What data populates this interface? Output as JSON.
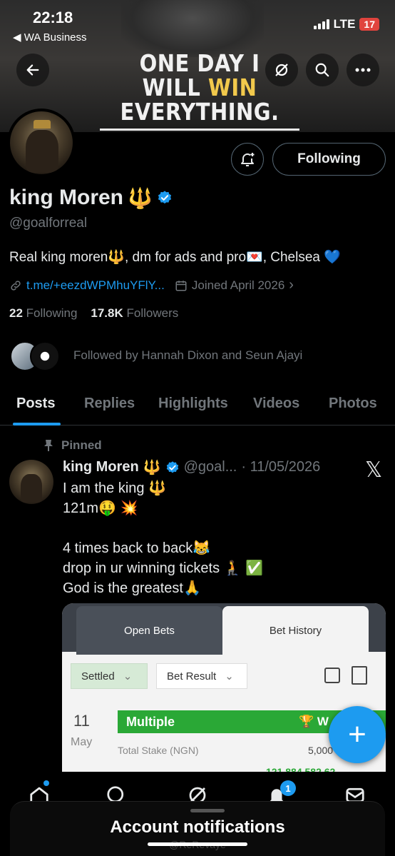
{
  "status_bar": {
    "time": "22:18",
    "back_app": "◀ WA Business",
    "network": "LTE",
    "battery": "17"
  },
  "banner": {
    "line1": "ONE DAY I",
    "line2a": "WILL ",
    "line2b": "WIN",
    "line3": "EVERYTHING."
  },
  "profile": {
    "name": "king Moren",
    "name_emoji": "🔱",
    "handle": "@goalforreal",
    "bio": "Real king moren🔱, dm for ads and pro💌, Chelsea 💙",
    "link": "t.me/+eezdWPMhuYFlY...",
    "joined": "Joined April 2026",
    "following_count": "22",
    "following_label": "Following",
    "followers_count": "17.8K",
    "followers_label": "Followers",
    "followed_by": "Followed by Hannah Dixon and Seun Ajayi",
    "following_button": "Following"
  },
  "tabs": [
    "Posts",
    "Replies",
    "Highlights",
    "Videos",
    "Photos"
  ],
  "post": {
    "pinned_label": "Pinned",
    "author": "king Moren",
    "author_emoji": "🔱",
    "handle": "@goal...",
    "date": "· 11/05/2026",
    "text": "I am the king 🔱\n121m🤑 💥\n\n4 times back to back😹\ndrop in ur winning tickets 🧎 ✅\nGod is the greatest🙏"
  },
  "embed": {
    "tab_open": "Open Bets",
    "tab_history": "Bet History",
    "filter_settled": "Settled",
    "filter_result": "Bet Result",
    "day": "11",
    "month": "May",
    "bet_type": "Multiple",
    "bet_status": "W",
    "stake_label": "Total Stake (NGN)",
    "stake_value": "5,000",
    "win_value": "121,884,582.62"
  },
  "bottom": {
    "notification_badge": "1",
    "toast_title": "Account notifications",
    "toast_sub": "@ReRevaye"
  },
  "colors": {
    "accent": "#1d9bf0",
    "secondary_text": "#71767b",
    "win_gold": "#f2c94c",
    "bet_green": "#2aa836"
  }
}
